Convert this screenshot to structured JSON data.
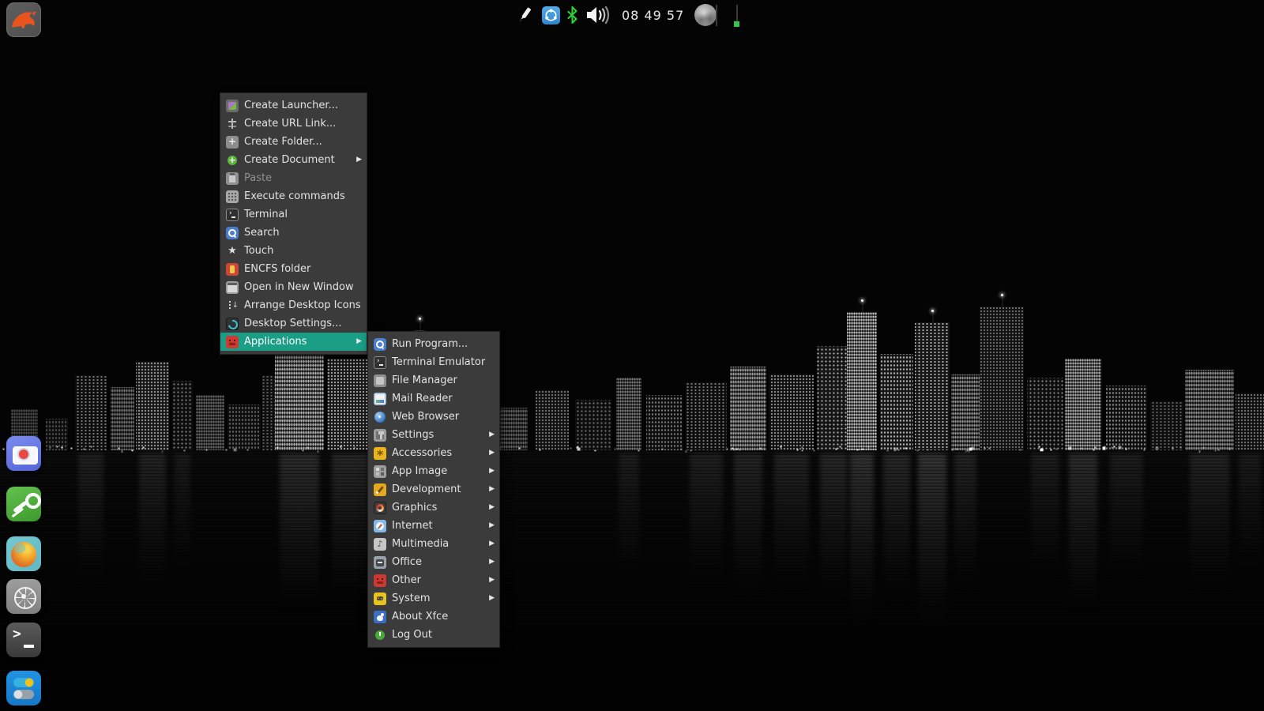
{
  "colors": {
    "menu_highlight": "#1a9e86",
    "menu_background": "#3b3b3b",
    "menu_text": "#e2e2e2",
    "menu_text_disabled": "#909090",
    "bluetooth_green": "#2fd135",
    "workspace_dot_green": "#35c34a"
  },
  "top_bar": {
    "launcher": {
      "icon": "dolphin-icon"
    },
    "tray": {
      "stylus": {
        "icon": "stylus-icon"
      },
      "network": {
        "icon": "network-share-icon"
      },
      "bluetooth": {
        "icon": "bluetooth-icon"
      },
      "volume": {
        "icon": "volume-icon"
      },
      "clock": "08 49 57",
      "moon": {
        "icon": "moon-phase-icon"
      }
    }
  },
  "dock": {
    "items": [
      {
        "name": "camera",
        "icon": "camera-icon"
      },
      {
        "name": "key",
        "icon": "key-icon"
      },
      {
        "name": "firefox",
        "icon": "firefox-icon"
      },
      {
        "name": "kubernetes",
        "icon": "helm-wheel-icon"
      },
      {
        "name": "terminal",
        "icon": "terminal-icon"
      },
      {
        "name": "settings-toggles",
        "icon": "toggles-icon"
      }
    ]
  },
  "context_menu": {
    "items": [
      {
        "label": "Create Launcher...",
        "icon": "create-launcher"
      },
      {
        "label": "Create URL Link...",
        "icon": "create-url-link"
      },
      {
        "label": "Create Folder...",
        "icon": "create-folder"
      },
      {
        "label": "Create Document",
        "icon": "create-document",
        "submenu": true
      },
      {
        "label": "Paste",
        "icon": "paste",
        "disabled": true
      },
      {
        "label": "Execute commands",
        "icon": "execute-commands"
      },
      {
        "label": "Terminal",
        "icon": "terminal"
      },
      {
        "label": "Search",
        "icon": "search"
      },
      {
        "label": "Touch",
        "icon": "touch-star"
      },
      {
        "label": "ENCFS folder",
        "icon": "encfs-folder"
      },
      {
        "label": "Open in New Window",
        "icon": "open-window"
      },
      {
        "label": "Arrange Desktop Icons",
        "icon": "arrange-icons"
      },
      {
        "label": "Desktop Settings...",
        "icon": "desktop-settings"
      },
      {
        "label": "Applications",
        "icon": "applications-other",
        "submenu": true,
        "selected": true
      }
    ]
  },
  "applications_submenu": {
    "items": [
      {
        "label": "Run Program...",
        "icon": "run-program"
      },
      {
        "label": "Terminal Emulator",
        "icon": "terminal"
      },
      {
        "label": "File Manager",
        "icon": "file-manager"
      },
      {
        "label": "Mail Reader",
        "icon": "mail-reader"
      },
      {
        "label": "Web Browser",
        "icon": "web-browser"
      },
      {
        "label": "Settings",
        "icon": "settings",
        "submenu": true
      },
      {
        "label": "Accessories",
        "icon": "accessories",
        "submenu": true
      },
      {
        "label": "App Image",
        "icon": "app-image",
        "submenu": true
      },
      {
        "label": "Development",
        "icon": "development",
        "submenu": true
      },
      {
        "label": "Graphics",
        "icon": "graphics",
        "submenu": true
      },
      {
        "label": "Internet",
        "icon": "internet",
        "submenu": true
      },
      {
        "label": "Multimedia",
        "icon": "multimedia",
        "submenu": true
      },
      {
        "label": "Office",
        "icon": "office",
        "submenu": true
      },
      {
        "label": "Other",
        "icon": "other",
        "submenu": true
      },
      {
        "label": "System",
        "icon": "system",
        "submenu": true
      },
      {
        "label": "About Xfce",
        "icon": "about-xfce"
      },
      {
        "label": "Log Out",
        "icon": "log-out"
      }
    ]
  }
}
